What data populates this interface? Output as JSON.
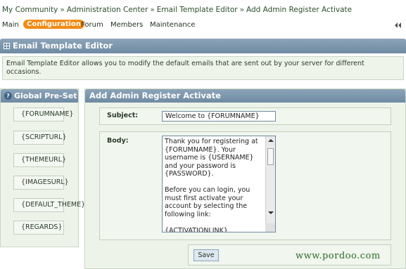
{
  "breadcrumb": {
    "items": [
      "My Community",
      "Administration Center",
      "Email Template Editor",
      "Add Admin Register Activate"
    ],
    "separator": "»"
  },
  "nav": {
    "items": [
      "Main",
      "Configuration",
      "Forum",
      "Members",
      "Maintenance"
    ],
    "active": "Configuration",
    "collapse_icon": "double-chevron-left-icon"
  },
  "page_header": {
    "title": "Email Template Editor",
    "icon": "grid-icon"
  },
  "description": "Email Template Editor allows you to modify the default emails that are sent out by your server for different occasions.",
  "presets": {
    "title": "Global Pre-Set",
    "icon": "help-icon",
    "items": [
      "{FORUMNAME}",
      "{SCRIPTURL}",
      "{THEMEURL}",
      "{IMAGESURL}",
      "{DEFAULT_THEME}",
      "{REGARDS}"
    ]
  },
  "editor": {
    "title": "Add Admin Register Activate",
    "subject_label": "Subject:",
    "subject_value": "Welcome to {FORUMNAME}",
    "body_label": "Body:",
    "body_value": "Thank you for registering at {FORUMNAME}. Your username is {USERNAME} and your password is {PASSWORD}.\n\nBefore you can login, you must first activate your account by selecting the following link:\n\n{ACTIVATIONLINK}",
    "save_label": "Save"
  },
  "watermark": "www.pordoo.com",
  "colors": {
    "accent": "#f18a14",
    "header": "#7a95ac",
    "panel_bg": "#eef3ea"
  }
}
